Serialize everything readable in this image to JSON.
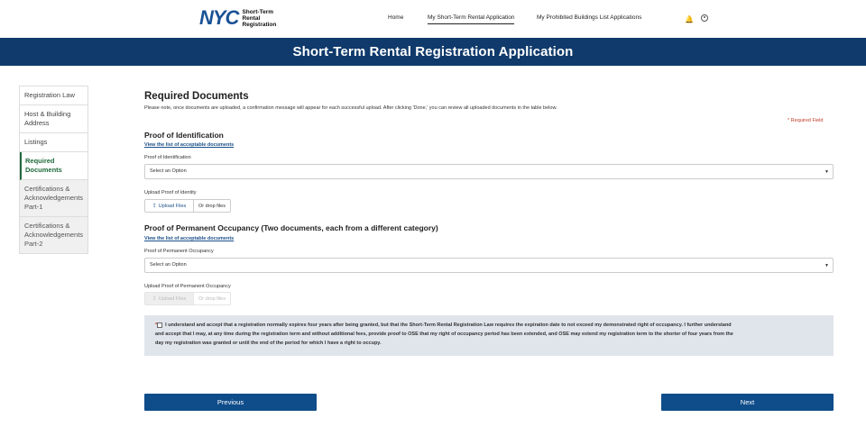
{
  "header": {
    "logo_mark": "NYC",
    "logo_line1": "Short-Term",
    "logo_line2": "Rental",
    "logo_line3": "Registration",
    "nav": [
      "Home",
      "My Short-Term Rental Application",
      "My Prohibited Buildings List Applications"
    ],
    "icons": [
      "bell-icon",
      "user-icon"
    ]
  },
  "banner": {
    "title": "Short-Term Rental Registration Application"
  },
  "sidebar": {
    "items": [
      {
        "label": "Registration Law"
      },
      {
        "label": "Host & Building Address"
      },
      {
        "label": "Listings"
      },
      {
        "label": "Required Documents"
      },
      {
        "label": "Certifications & Acknowledgements Part-1"
      },
      {
        "label": "Certifications & Acknowledgements Part-2"
      }
    ]
  },
  "main": {
    "title": "Required Documents",
    "intro": "Please note, once documents are uploaded, a confirmation message will appear for each successful upload. After clicking 'Done,' you can review all uploaded documents in the table below.",
    "required_note": "*  Required Field",
    "identity": {
      "title": "Proof of Identification",
      "link": "View the list of acceptable documents",
      "select_label": "Proof of Identification",
      "select_value": "Select an Option",
      "upload_label": "Upload Proof of Identity",
      "upload_button": "Upload Files",
      "drop_text": "Or drop files"
    },
    "occupancy": {
      "title": "Proof of Permanent Occupancy (Two documents, each from a different category)",
      "link": "View the list of acceptable documents",
      "select_label": "Proof of Permanent Occupancy",
      "select_value": "Select an Option",
      "upload_label": "Upload Proof of Permanent Occupancy",
      "upload_button": "Upload Files",
      "drop_text": "Or drop files"
    },
    "acknowledgement": {
      "star": "*",
      "line1": "I understand and accept that a registration normally expires four years after being granted, but that the Short-Term Rental Registration Law requires the expiration date to not exceed my demonstrated right of occupancy. I further understand",
      "line2": "and accept that I may, at any time during the registration term and without additional fees, provide proof to OSE that my right of occupancy period has been extended, and OSE may extend my registration term to the shorter of four years from the",
      "line3": "day my registration was granted or until the end of the period for which I have a right to occupy."
    }
  },
  "footer": {
    "previous": "Previous",
    "next": "Next"
  }
}
